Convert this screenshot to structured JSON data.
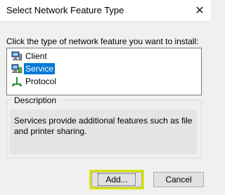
{
  "window": {
    "title": "Select Network Feature Type",
    "close_glyph": "✕"
  },
  "prompt": "Click the type of network feature you want to install:",
  "features": [
    {
      "label": "Client",
      "icon": "client-computer-icon",
      "selected": false
    },
    {
      "label": "Service",
      "icon": "service-icon",
      "selected": true
    },
    {
      "label": "Protocol",
      "icon": "protocol-icon",
      "selected": false
    }
  ],
  "description": {
    "heading": "Description",
    "text": "Services provide additional features such as file and printer sharing."
  },
  "buttons": {
    "add": "Add...",
    "cancel": "Cancel"
  },
  "colors": {
    "selection": "#0078d7",
    "highlight": "#d8e600"
  }
}
